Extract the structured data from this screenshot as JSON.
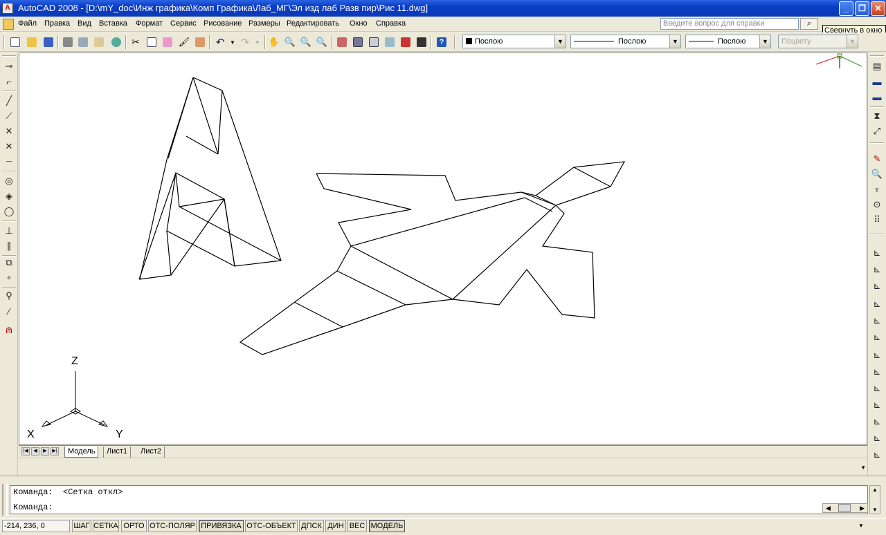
{
  "window": {
    "app_icon": "A",
    "title": "AutoCAD 2008 - [D:\\mY_doc\\Инж графика\\Комп Графика\\Лаб_МГ\\Эл изд лаб Разв пир\\Рис 11.dwg]",
    "minimize": "_",
    "restore": "❐",
    "close": "✕"
  },
  "menu": {
    "items": [
      "Файл",
      "Правка",
      "Вид",
      "Вставка",
      "Формат",
      "Сервис",
      "Рисование",
      "Размеры",
      "Редактировать",
      "Окно",
      "Справка"
    ],
    "help_placeholder": "Введите вопрос для справки",
    "tooltip": "Свернуть в окно"
  },
  "properties": {
    "color": "Послою",
    "linetype": "Послою",
    "lineweight": "Послою",
    "plotstyle": "Поцвету"
  },
  "ucs": {
    "z": "Z",
    "x": "X",
    "y": "Y"
  },
  "layout_tabs": [
    "Модель",
    "Лист1",
    "Лист2"
  ],
  "command": {
    "line1": "Команда:  <Сетка откл>",
    "line2": "Команда:"
  },
  "status": {
    "coords": "-214, 236, 0",
    "buttons": [
      "ШАГ",
      "СЕТКА",
      "ОРТО",
      "ОТС-ПОЛЯР",
      "ПРИВЯЗКА",
      "ОТС-ОБЪЕКТ",
      "ДПСК",
      "ДИН",
      "ВЕС",
      "МОДЕЛЬ"
    ],
    "active": [
      "ПРИВЯЗКА",
      "МОДЕЛЬ"
    ]
  },
  "icons": {
    "toolbar": [
      "new-icon",
      "open-icon",
      "save-icon",
      "plot-icon",
      "preview-icon",
      "publish-icon",
      "3dwf-icon",
      "cut-icon",
      "copy-icon",
      "paste-icon",
      "matchprop-icon",
      "blockeditor-icon",
      "undo-icon",
      "redo-icon",
      "pan-icon",
      "zoom-realtime-icon",
      "zoom-window-icon",
      "zoom-previous-icon",
      "properties-icon",
      "designcenter-icon",
      "toolpalettes-icon",
      "sheetset-icon",
      "markup-icon",
      "calculator-icon",
      "help-icon"
    ],
    "left": [
      "line-icon",
      "xline-icon",
      "polyline-icon",
      "spline-icon",
      "intersection-icon",
      "apparent-intersection-icon",
      "extension-icon",
      "center-icon",
      "quadrant-icon",
      "tangent-icon",
      "perpendicular-icon",
      "parallel-icon",
      "insert-icon",
      "node-icon",
      "nearest-icon",
      "none-icon",
      "osnap-settings-icon"
    ],
    "right": [
      "ucs-icon",
      "world-icon",
      "object-icon",
      "face-icon",
      "view-icon",
      "origin-icon",
      "zaxis-icon",
      "3point-icon",
      "x-icon",
      "y-icon",
      "z-icon",
      "apply-icon",
      "named-ucs-icon",
      "ucs-previous-icon"
    ]
  },
  "colors": {
    "title_bar": "#0a3cc6",
    "chrome": "#ece9d8",
    "canvas": "#ffffff",
    "linework": "#000000"
  }
}
